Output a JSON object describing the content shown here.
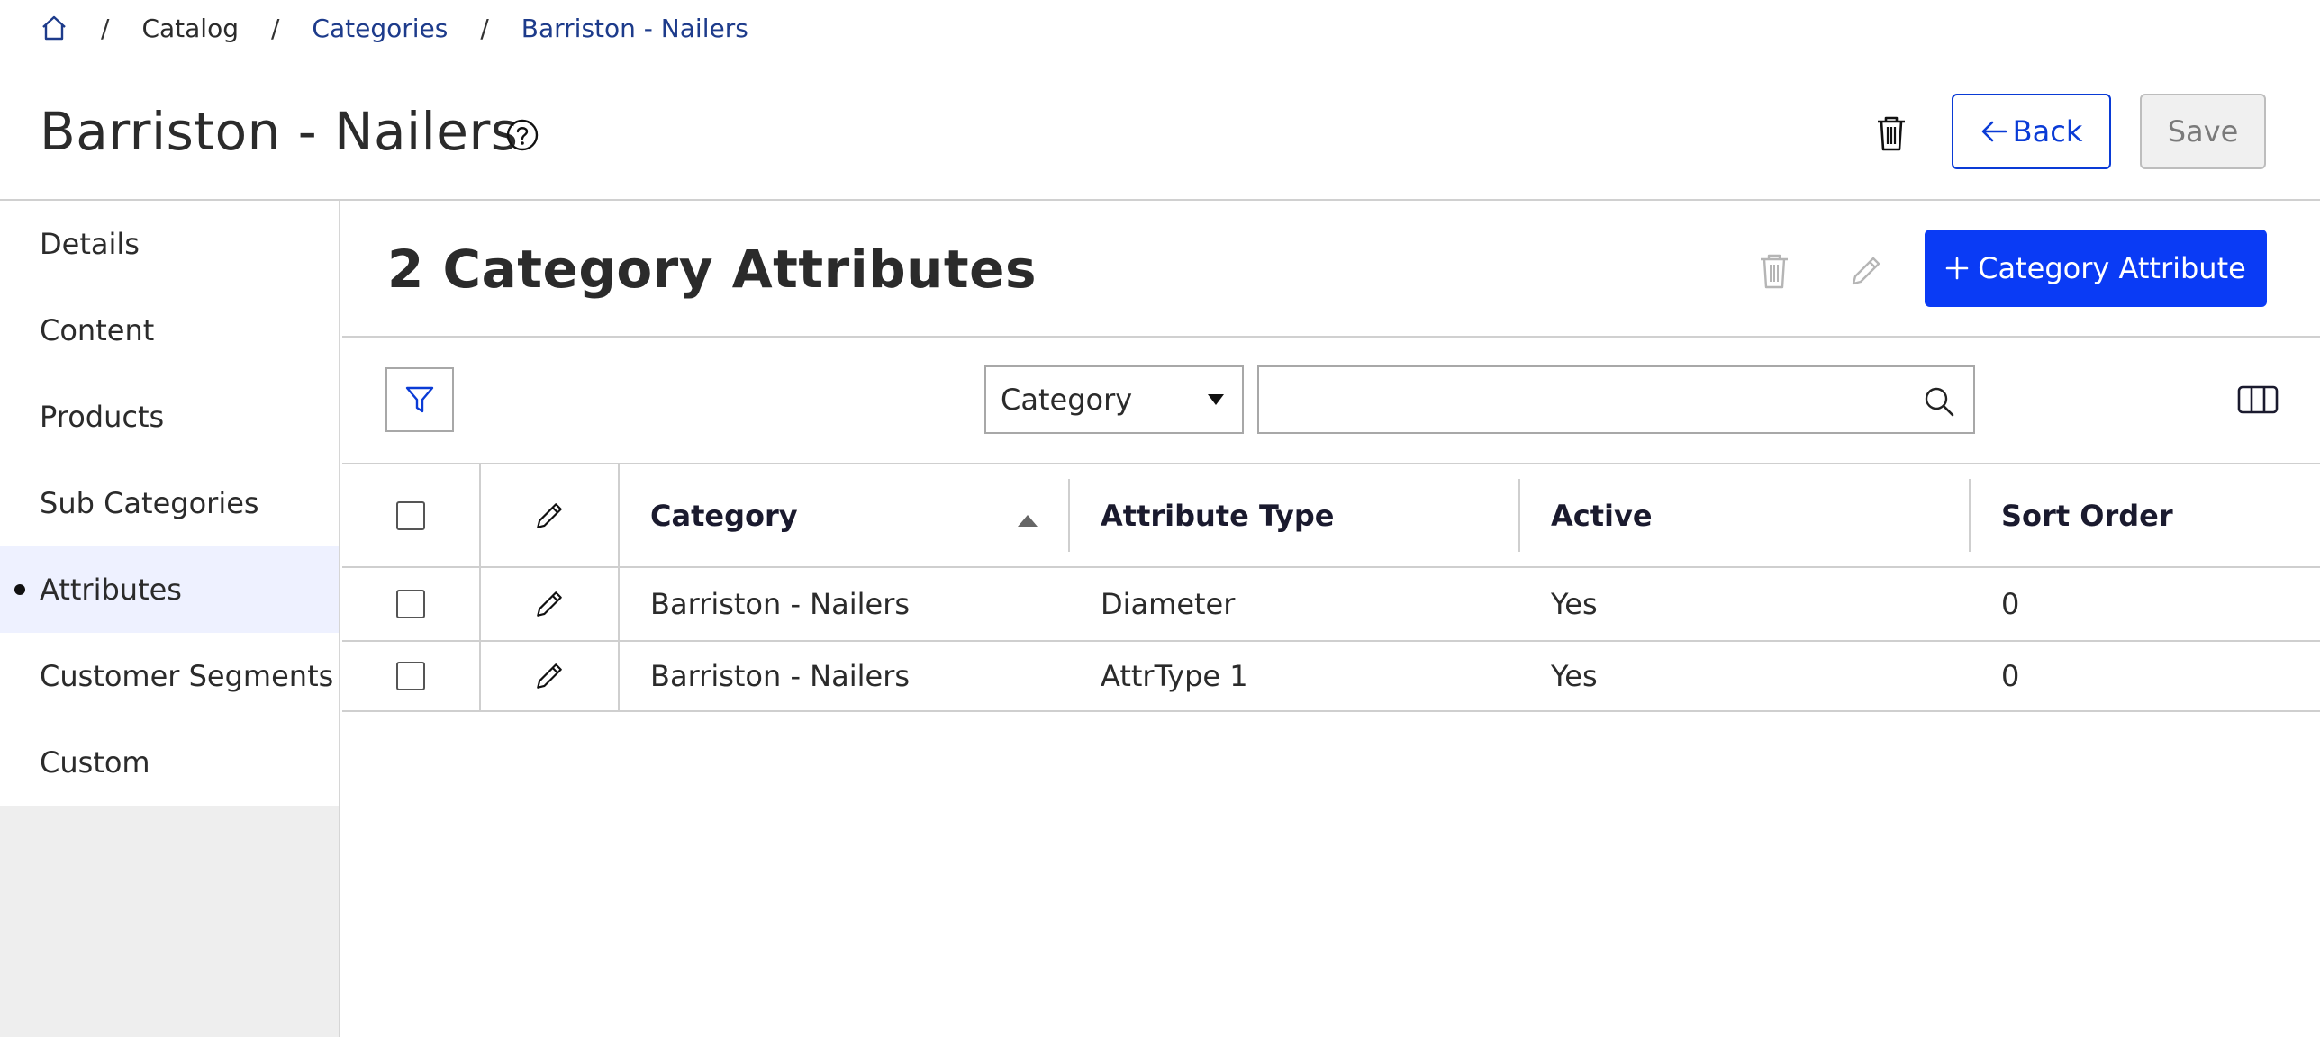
{
  "breadcrumb": {
    "items": [
      "Catalog",
      "Categories",
      "Barriston - Nailers"
    ],
    "separator": "/"
  },
  "header": {
    "title": "Barriston - Nailers",
    "back_label": "Back",
    "save_label": "Save"
  },
  "sidebar": {
    "items": [
      {
        "label": "Details"
      },
      {
        "label": "Content"
      },
      {
        "label": "Products"
      },
      {
        "label": "Sub Categories"
      },
      {
        "label": "Attributes",
        "active": true
      },
      {
        "label": "Customer Segments"
      },
      {
        "label": "Custom"
      }
    ]
  },
  "section": {
    "title": "2 Category Attributes",
    "add_label": "Category Attribute"
  },
  "filters": {
    "select_value": "Category",
    "search_value": ""
  },
  "table": {
    "columns": [
      "Category",
      "Attribute Type",
      "Active",
      "Sort Order"
    ],
    "sort_column": "Category",
    "rows": [
      {
        "category": "Barriston - Nailers",
        "attribute_type": "Diameter",
        "active": "Yes",
        "sort_order": "0"
      },
      {
        "category": "Barriston - Nailers",
        "attribute_type": "AttrType 1",
        "active": "Yes",
        "sort_order": "0"
      }
    ]
  },
  "colors": {
    "primary": "#0a3bf5",
    "link": "#1d3b8b",
    "active_nav_bg": "#eef1ff",
    "sidebar_bg": "#eeeeee"
  },
  "icons": {
    "home": "home-icon",
    "help": "help-circle-icon",
    "trash": "trash-icon",
    "edit": "pencil-icon",
    "filter": "filter-icon",
    "search": "search-icon",
    "columns": "columns-icon"
  }
}
